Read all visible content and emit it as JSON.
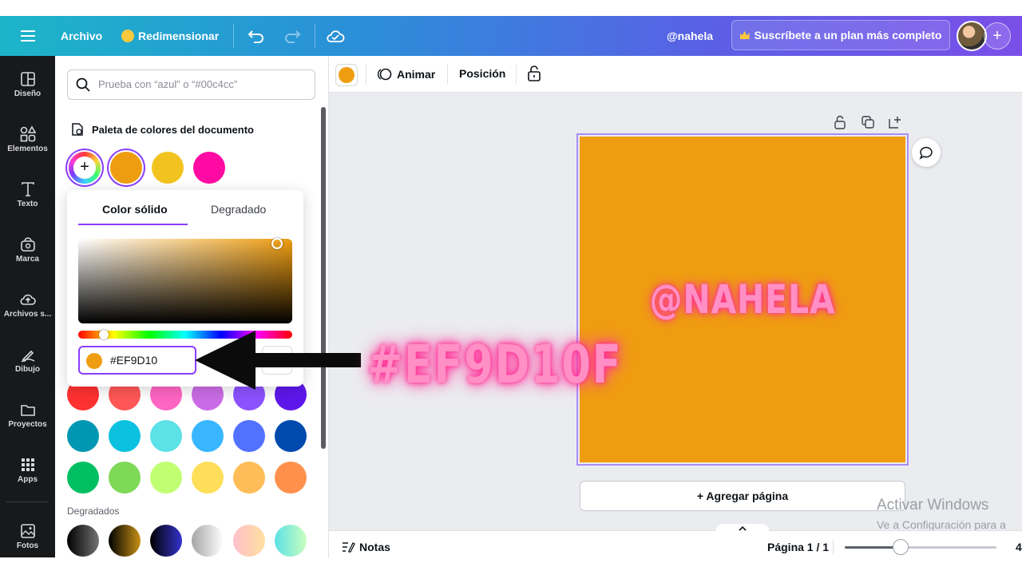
{
  "topbar": {
    "file": "Archivo",
    "resize": "Redimensionar",
    "user": "@nahela",
    "cta": "Suscríbete a un plan más completo"
  },
  "rail": {
    "items": [
      {
        "label": "Diseño",
        "icon": "layout-icon"
      },
      {
        "label": "Elementos",
        "icon": "shapes-icon"
      },
      {
        "label": "Texto",
        "icon": "text-icon"
      },
      {
        "label": "Marca",
        "icon": "brand-icon"
      },
      {
        "label": "Archivos s...",
        "icon": "cloud-upload-icon"
      },
      {
        "label": "Dibujo",
        "icon": "pen-icon"
      },
      {
        "label": "Proyectos",
        "icon": "folder-icon"
      },
      {
        "label": "Apps",
        "icon": "apps-grid-icon"
      },
      {
        "label": "Fotos",
        "icon": "photo-icon"
      }
    ]
  },
  "panel": {
    "search_placeholder": "Prueba con “azul” o “#00c4cc”",
    "palette_title": "Paleta de colores del documento",
    "palette": [
      "#ef9d10",
      "#f2c31f",
      "#ff0aa2"
    ],
    "solid_colors": [
      "#ff3131",
      "#ff5757",
      "#ff66c4",
      "#cb6ce6",
      "#8c52ff",
      "#5e17eb",
      "#0097b2",
      "#0cc0df",
      "#5ce1e6",
      "#38b6ff",
      "#5271ff",
      "#004aad",
      "#00bf63",
      "#7ed957",
      "#c1ff72",
      "#ffde59",
      "#ffbd59",
      "#ff914d"
    ],
    "gradients_label": "Degradados",
    "gradients": [
      [
        "#000000",
        "#737373"
      ],
      [
        "#000000",
        "#c89116"
      ],
      [
        "#000000",
        "#3533cd"
      ],
      [
        "#a6a6a6",
        "#ffffff"
      ],
      [
        "#ffc0cb",
        "#ffe0a0"
      ],
      [
        "#5de0e6",
        "#c9ffbf"
      ]
    ]
  },
  "picker": {
    "tab_solid": "Color sólido",
    "tab_gradient": "Degradado",
    "hex_value": "#EF9D10",
    "selected_color": "#ef9d10"
  },
  "editor": {
    "animate": "Animar",
    "position": "Posición",
    "page_text": "@NAHELA",
    "page_color": "#ef9d10",
    "add_page": "+ Agregar página",
    "notes": "Notas",
    "page_indicator": "Página 1 / 1",
    "zoom_label": "4",
    "zoom_fraction": 0.37
  },
  "overlay": {
    "hex_caption": "#EF9D10F"
  },
  "watermark": {
    "line1": "Activar Windows",
    "line2": "Ve a Configuración para a"
  },
  "colors": {
    "accent": "#8b3dff",
    "rail_bg": "#18191b"
  }
}
